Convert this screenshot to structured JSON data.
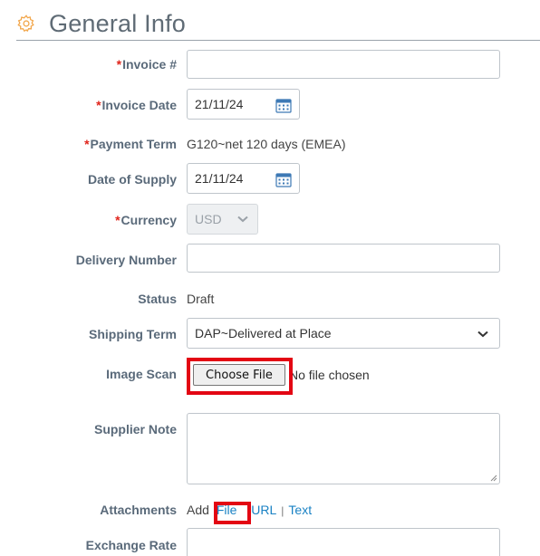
{
  "section": {
    "title": "General Info",
    "icon": "gear-icon"
  },
  "fields": {
    "invoice_number": {
      "label": "Invoice #",
      "required": true,
      "value": ""
    },
    "invoice_date": {
      "label": "Invoice Date",
      "required": true,
      "value": "21/11/24"
    },
    "payment_term": {
      "label": "Payment Term",
      "required": true,
      "value": "G120~net 120 days (EMEA)"
    },
    "date_of_supply": {
      "label": "Date of Supply",
      "value": "21/11/24"
    },
    "currency": {
      "label": "Currency",
      "required": true,
      "value": "USD"
    },
    "delivery_number": {
      "label": "Delivery Number",
      "value": ""
    },
    "status": {
      "label": "Status",
      "value": "Draft"
    },
    "shipping_term": {
      "label": "Shipping Term",
      "value": "DAP~Delivered at Place"
    },
    "image_scan": {
      "label": "Image Scan",
      "button_label": "Choose File",
      "status_text": "No file chosen"
    },
    "supplier_note": {
      "label": "Supplier Note",
      "value": ""
    },
    "attachments": {
      "label": "Attachments",
      "prefix": "Add",
      "links": [
        "File",
        "URL",
        "Text"
      ],
      "separator": "|"
    },
    "exchange_rate": {
      "label": "Exchange Rate",
      "value": ""
    }
  },
  "required_marker": "*",
  "colors": {
    "label": "#5a6a7a",
    "required": "#e0241b",
    "link": "#1a82c4",
    "highlight": "#e30613"
  }
}
